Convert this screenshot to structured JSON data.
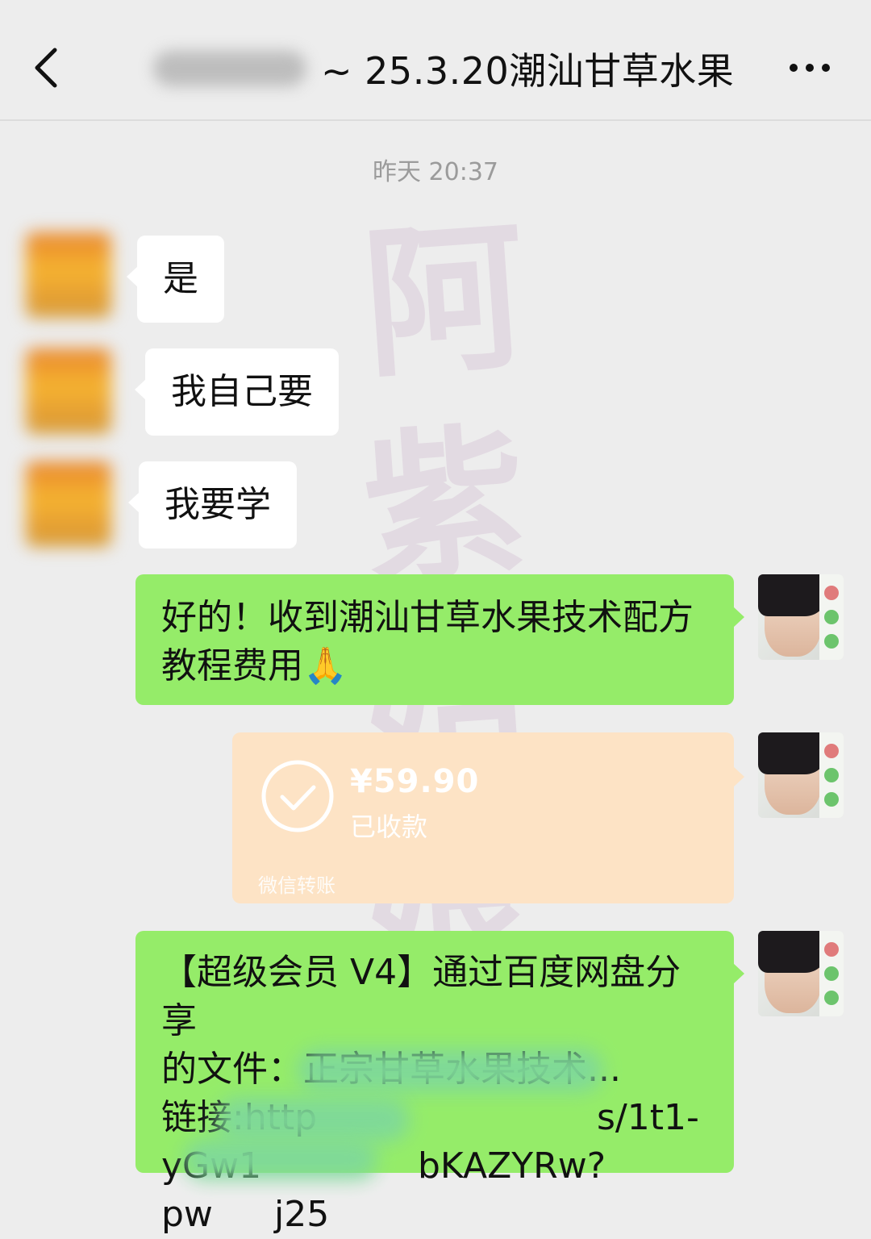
{
  "header": {
    "title": "~ 25.3.20潮汕甘草水果"
  },
  "watermark": {
    "chars": [
      "阿",
      "紫",
      "姑",
      "娘"
    ]
  },
  "chat": {
    "timestamp": "昨天 20:37",
    "incoming": [
      {
        "text": "是"
      },
      {
        "text": "我自己要"
      },
      {
        "text": "我要学"
      }
    ],
    "outgoing_1": {
      "line1": "好的！收到潮汕甘草水果技术配方",
      "line2": "教程费用🙏"
    },
    "transfer": {
      "amount": "¥59.90",
      "status": "已收款",
      "label": "微信转账"
    },
    "outgoing_2": {
      "line1": "【超级会员 V4】通过百度网盘分享",
      "line2": "的文件：正宗甘草水果技术...",
      "line3_prefix": "链接:",
      "line3_start": "http",
      "line3_end": "s/1t1-",
      "line4_start": "yGw1",
      "line4_end": "bKAZYRw?",
      "line5_start": "pw",
      "line5_end": "j25"
    }
  },
  "colors": {
    "background": "#ededed",
    "outgoing_bubble": "#95ec69",
    "incoming_bubble": "#ffffff",
    "transfer_card": "#fde3c5",
    "watermark": "#8d3a86"
  }
}
